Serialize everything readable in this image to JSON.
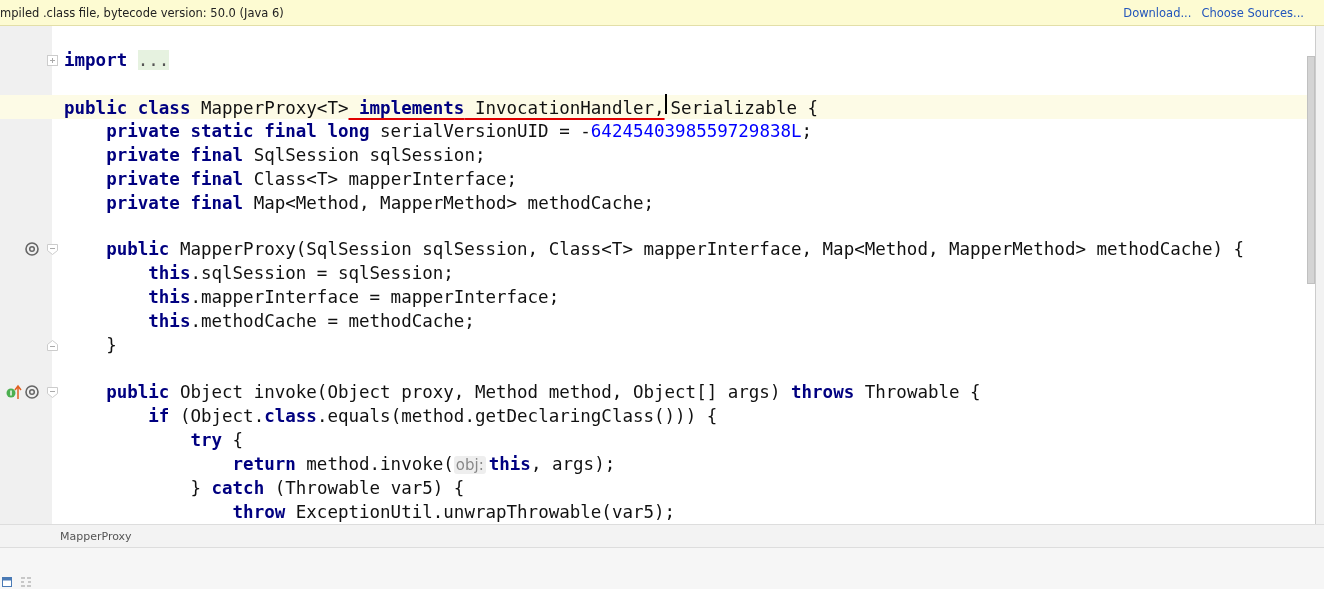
{
  "banner": {
    "message": "mpiled .class file, bytecode version: 50.0 (Java 6)",
    "links": [
      "Download...",
      "Choose Sources..."
    ]
  },
  "editor": {
    "lines": [
      {
        "fold_collapsed": true,
        "tokens": [
          {
            "kind": "kw",
            "text": "import "
          },
          {
            "kind": "folded",
            "text": "..."
          }
        ]
      },
      {
        "blank_before": true,
        "current": true,
        "tokens": [
          {
            "kind": "kw",
            "text": "public class"
          },
          {
            "kind": "plain",
            "text": " MapperProxy<T>"
          },
          {
            "kind": "kw",
            "text": " implements",
            "underlined": true
          },
          {
            "kind": "plain",
            "text": " InvocationHandler,",
            "underlined": true,
            "caret": true
          },
          {
            "kind": "plain",
            "text": "Serializable {"
          }
        ]
      },
      {
        "tokens": [
          {
            "kind": "kw",
            "text": "    private static final long"
          },
          {
            "kind": "plain",
            "text": " serialVersionUID = -"
          },
          {
            "kind": "num",
            "text": "6424540398559729838L"
          },
          {
            "kind": "plain",
            "text": ";"
          }
        ]
      },
      {
        "tokens": [
          {
            "kind": "kw",
            "text": "    private final"
          },
          {
            "kind": "plain",
            "text": " SqlSession sqlSession;"
          }
        ]
      },
      {
        "tokens": [
          {
            "kind": "kw",
            "text": "    private final"
          },
          {
            "kind": "plain",
            "text": " Class<T> mapperInterface;"
          }
        ]
      },
      {
        "tokens": [
          {
            "kind": "kw",
            "text": "    private final"
          },
          {
            "kind": "plain",
            "text": " Map<Method, MapperMethod> methodCache;"
          }
        ]
      },
      {
        "blank_before": true,
        "annotation": true,
        "fold_start": true,
        "tokens": [
          {
            "kind": "kw",
            "text": "    public"
          },
          {
            "kind": "plain",
            "text": " MapperProxy(SqlSession sqlSession, Class<T> mapperInterface, Map<Method, MapperMethod> methodCache) {"
          }
        ]
      },
      {
        "tokens": [
          {
            "kind": "kw",
            "text": "        this"
          },
          {
            "kind": "plain",
            "text": ".sqlSession = sqlSession;"
          }
        ]
      },
      {
        "tokens": [
          {
            "kind": "kw",
            "text": "        this"
          },
          {
            "kind": "plain",
            "text": ".mapperInterface = mapperInterface;"
          }
        ]
      },
      {
        "tokens": [
          {
            "kind": "kw",
            "text": "        this"
          },
          {
            "kind": "plain",
            "text": ".methodCache = methodCache;"
          }
        ]
      },
      {
        "fold_end": true,
        "tokens": [
          {
            "kind": "plain",
            "text": "    }"
          }
        ]
      },
      {
        "blank_before": true,
        "implements": true,
        "annotation": true,
        "fold_start": true,
        "tokens": [
          {
            "kind": "kw",
            "text": "    public"
          },
          {
            "kind": "plain",
            "text": " Object invoke(Object proxy, Method method, Object[] args) "
          },
          {
            "kind": "kw",
            "text": "throws"
          },
          {
            "kind": "plain",
            "text": " Throwable {"
          }
        ]
      },
      {
        "tokens": [
          {
            "kind": "kw",
            "text": "        if"
          },
          {
            "kind": "plain",
            "text": " (Object."
          },
          {
            "kind": "kw",
            "text": "class"
          },
          {
            "kind": "plain",
            "text": ".equals(method.getDeclaringClass())) {"
          }
        ]
      },
      {
        "tokens": [
          {
            "kind": "kw",
            "text": "            try"
          },
          {
            "kind": "plain",
            "text": " {"
          }
        ]
      },
      {
        "tokens": [
          {
            "kind": "kw",
            "text": "                return"
          },
          {
            "kind": "plain",
            "text": " method.invoke("
          },
          {
            "kind": "hint",
            "text": "obj:"
          },
          {
            "kind": "kw",
            "text": "this"
          },
          {
            "kind": "plain",
            "text": ", args);"
          }
        ]
      },
      {
        "tokens": [
          {
            "kind": "plain",
            "text": "            } "
          },
          {
            "kind": "kw",
            "text": "catch"
          },
          {
            "kind": "plain",
            "text": " (Throwable var5) {"
          }
        ]
      },
      {
        "tokens": [
          {
            "kind": "kw",
            "text": "                throw"
          },
          {
            "kind": "plain",
            "text": " ExceptionUtil.unwrapThrowable(var5);"
          }
        ]
      }
    ]
  },
  "breadcrumb": "MapperProxy"
}
